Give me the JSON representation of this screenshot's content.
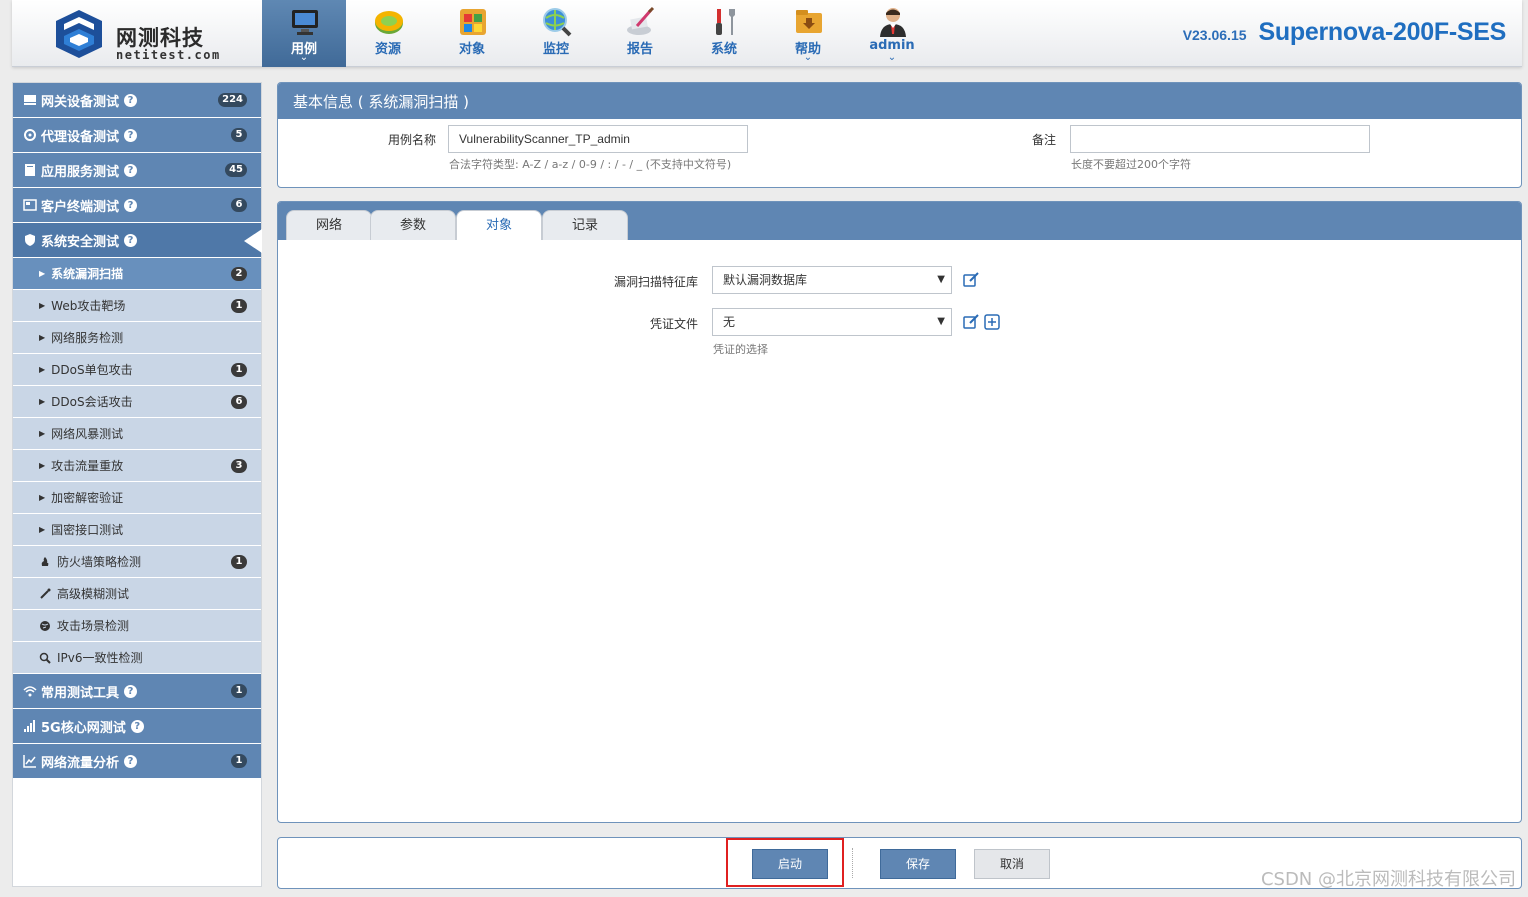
{
  "header": {
    "logo_cn": "网测科技",
    "logo_en": "netitest.com",
    "version": "V23.06.15",
    "model": "Supernova-200F-SES",
    "nav": [
      {
        "label": "用例",
        "icon": "monitor-icon",
        "active": true,
        "caret": "⌄"
      },
      {
        "label": "资源",
        "icon": "disc-icon",
        "active": false,
        "caret": ""
      },
      {
        "label": "对象",
        "icon": "windows-blocks-icon",
        "active": false,
        "caret": ""
      },
      {
        "label": "监控",
        "icon": "globe-magnifier-icon",
        "active": false,
        "caret": ""
      },
      {
        "label": "报告",
        "icon": "report-pen-icon",
        "active": false,
        "caret": ""
      },
      {
        "label": "系统",
        "icon": "tools-icon",
        "active": false,
        "caret": ""
      },
      {
        "label": "帮助",
        "icon": "help-folder-icon",
        "active": false,
        "caret": "⌄"
      },
      {
        "label": "admin",
        "icon": "user-icon",
        "active": false,
        "caret": "⌄"
      }
    ]
  },
  "sidebar": {
    "sections_top": [
      {
        "label": "网关设备测试",
        "badge": "224",
        "icon": "hdd-icon"
      },
      {
        "label": "代理设备测试",
        "badge": "5",
        "icon": "gear-icon"
      },
      {
        "label": "应用服务测试",
        "badge": "45",
        "icon": "server-icon"
      },
      {
        "label": "客户终端测试",
        "badge": "6",
        "icon": "terminal-icon"
      },
      {
        "label": "系统安全测试",
        "badge": "",
        "icon": "shield-icon"
      }
    ],
    "items": [
      {
        "label": "系统漏洞扫描",
        "badge": "2",
        "active": true,
        "icon": "triangle"
      },
      {
        "label": "Web攻击靶场",
        "badge": "1",
        "active": false,
        "icon": "triangle"
      },
      {
        "label": "网络服务检测",
        "badge": "",
        "active": false,
        "icon": "triangle"
      },
      {
        "label": "DDoS单包攻击",
        "badge": "1",
        "active": false,
        "icon": "triangle"
      },
      {
        "label": "DDoS会话攻击",
        "badge": "6",
        "active": false,
        "icon": "triangle"
      },
      {
        "label": "网络风暴测试",
        "badge": "",
        "active": false,
        "icon": "triangle"
      },
      {
        "label": "攻击流量重放",
        "badge": "3",
        "active": false,
        "icon": "triangle"
      },
      {
        "label": "加密解密验证",
        "badge": "",
        "active": false,
        "icon": "triangle"
      },
      {
        "label": "国密接口测试",
        "badge": "",
        "active": false,
        "icon": "triangle"
      },
      {
        "label": "防火墙策略检测",
        "badge": "1",
        "active": false,
        "icon": "fire-icon"
      },
      {
        "label": "高级模糊测试",
        "badge": "",
        "active": false,
        "icon": "wand-icon"
      },
      {
        "label": "攻击场景检测",
        "badge": "",
        "active": false,
        "icon": "globe-icon"
      },
      {
        "label": "IPv6一致性检测",
        "badge": "",
        "active": false,
        "icon": "magnifier-icon"
      }
    ],
    "sections_bottom": [
      {
        "label": "常用测试工具",
        "badge": "1",
        "icon": "wifi-icon"
      },
      {
        "label": "5G核心网测试",
        "badge": "",
        "icon": "signal-bars-icon"
      },
      {
        "label": "网络流量分析",
        "badge": "1",
        "icon": "area-chart-icon"
      }
    ],
    "help_glyph": "?"
  },
  "info": {
    "title": "基本信息 ( 系统漏洞扫描 )",
    "name_label": "用例名称",
    "name_value": "VulnerabilityScanner_TP_admin",
    "name_hint": "合法字符类型: A-Z / a-z / 0-9 / : / - / _ (不支持中文符号)",
    "remark_label": "备注",
    "remark_value": "",
    "remark_hint": "长度不要超过200个字符"
  },
  "tabs": [
    {
      "label": "网络",
      "active": false
    },
    {
      "label": "参数",
      "active": false
    },
    {
      "label": "对象",
      "active": true
    },
    {
      "label": "记录",
      "active": false
    }
  ],
  "object_tab": {
    "vuln_db_label": "漏洞扫描特征库",
    "vuln_db_value": "默认漏洞数据库",
    "cred_label": "凭证文件",
    "cred_value": "无",
    "cred_hint": "凭证的选择"
  },
  "buttons": {
    "start": "启动",
    "save": "保存",
    "cancel": "取消"
  },
  "watermark": "CSDN @北京网测科技有限公司",
  "colors": {
    "accent": "#5f86b3",
    "nav_active": "#406a98",
    "sidebar_item": "#c9d6e6",
    "highlight_box": "#e02020",
    "brand_blue": "#1f6ec0"
  }
}
